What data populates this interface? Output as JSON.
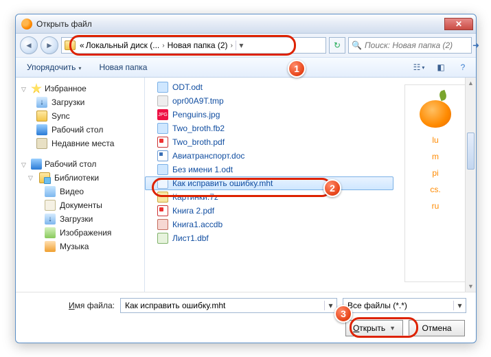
{
  "window": {
    "title": "Открыть файл"
  },
  "nav": {
    "crumb_prefix": "«",
    "crumb1": "Локальный диск (...",
    "crumb2": "Новая папка (2)"
  },
  "search": {
    "placeholder": "Поиск: Новая папка (2)"
  },
  "toolbar": {
    "organize": "Упорядочить",
    "newfolder": "Новая папка"
  },
  "sidebar": {
    "favorites": "Избранное",
    "downloads": "Загрузки",
    "sync": "Sync",
    "desktop": "Рабочий стол",
    "recent": "Недавние места",
    "desktop2": "Рабочий стол",
    "libraries": "Библиотеки",
    "video": "Видео",
    "documents": "Документы",
    "downloads2": "Загрузки",
    "images": "Изображения",
    "music": "Музыка"
  },
  "files": [
    {
      "name": "ODT.odt",
      "type": "odt"
    },
    {
      "name": "opr00A9T.tmp",
      "type": "tmp"
    },
    {
      "name": "Penguins.jpg",
      "type": "jpg"
    },
    {
      "name": "Two_broth.fb2",
      "type": "fb2"
    },
    {
      "name": "Two_broth.pdf",
      "type": "pdf"
    },
    {
      "name": "Авиатранспорт.doc",
      "type": "docm"
    },
    {
      "name": "Без имени 1.odt",
      "type": "odt"
    },
    {
      "name": "Как исправить ошибку.mht",
      "type": "mht",
      "selected": true
    },
    {
      "name": "Картинки.7z",
      "type": "7z"
    },
    {
      "name": "Книга 2.pdf",
      "type": "pdf"
    },
    {
      "name": "Книга1.accdb",
      "type": "acc"
    },
    {
      "name": "Лист1.dbf",
      "type": "dbf"
    }
  ],
  "preview": {
    "line1": "lu",
    "line2": "m",
    "line3": "pi",
    "line4": "cs.",
    "line5": "ru"
  },
  "bottom": {
    "filename_label_pre": "Имя файла:",
    "filename_label_u": "И",
    "filename_label_rest": "мя файла:",
    "filename_value": "Как исправить ошибку.mht",
    "filter": "Все файлы (*.*)",
    "open_u": "О",
    "open_rest": "ткрыть",
    "cancel": "Отмена"
  },
  "badges": {
    "b1": "1",
    "b2": "2",
    "b3": "3"
  }
}
